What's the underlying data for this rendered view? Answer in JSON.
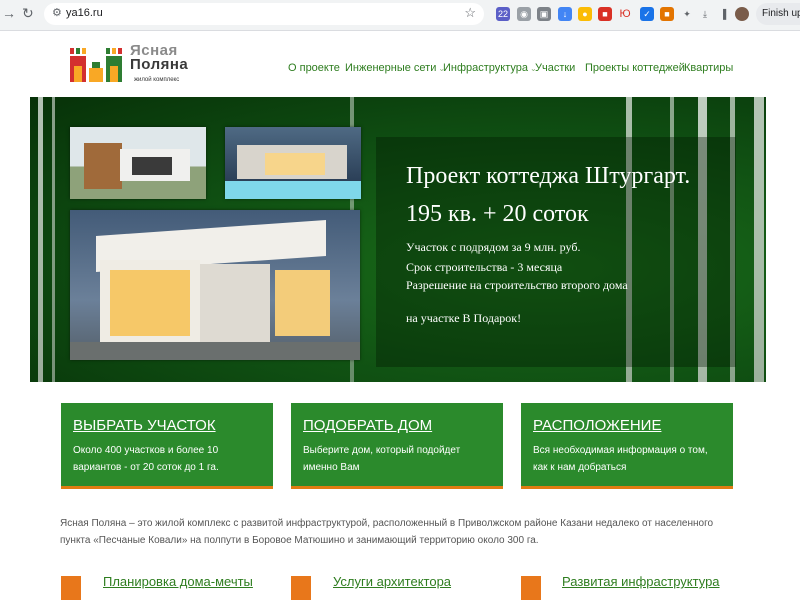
{
  "browser": {
    "url": "ya16.ru",
    "finish_label": "Finish upd",
    "ext_badge": "22",
    "ext_yu": "Ю"
  },
  "logo": {
    "line1": "Ясная",
    "line2": "Поляна",
    "subtitle": "жилой комплекс"
  },
  "menu": {
    "items": [
      {
        "label": "О проекте"
      },
      {
        "label": "Инженерные сети"
      },
      {
        "label": "Инфраструктура"
      },
      {
        "label": "Участки"
      },
      {
        "label": "Проекты коттеджей"
      },
      {
        "label": "Квартиры"
      }
    ]
  },
  "hero": {
    "title_line1": "Проект коттеджа Штургарт.",
    "title_line2": "195 кв. + 20 соток",
    "lines": [
      "Участок с подрядом за 9 млн. руб.",
      "Срок строительства - 3 месяца",
      "Разрешение на строительство второго дома"
    ],
    "promo": "на  участке В Подарок!"
  },
  "cards": [
    {
      "title": "Выбрать участок",
      "text": "Около 400 участков и более 10 вариантов - от 20 соток до 1 га."
    },
    {
      "title": "Подобрать дом",
      "text": "Выберите дом, который подойдет именно Вам"
    },
    {
      "title": "Расположение",
      "text": "Вся необходимая информация о том, как к нам добраться"
    }
  ],
  "about": "Ясная Поляна – это жилой комплекс с развитой инфраструктурой, расположенный в Приволжском районе Казани недалеко от населенного пункта «Песчаные Ковали» на полпути в Боровое Матюшино и занимающий территорию около 300 га.",
  "features": [
    {
      "title": "Планировка дома-мечты",
      "icon": "home-icon"
    },
    {
      "title": "Услуги архитектора",
      "icon": "pencil-icon"
    },
    {
      "title": "Развитая инфраструктура",
      "icon": "building-icon"
    }
  ],
  "colors": {
    "brand_green": "#2b8a2c",
    "accent_orange": "#e07c12",
    "menu_green": "#2e7d1f"
  }
}
